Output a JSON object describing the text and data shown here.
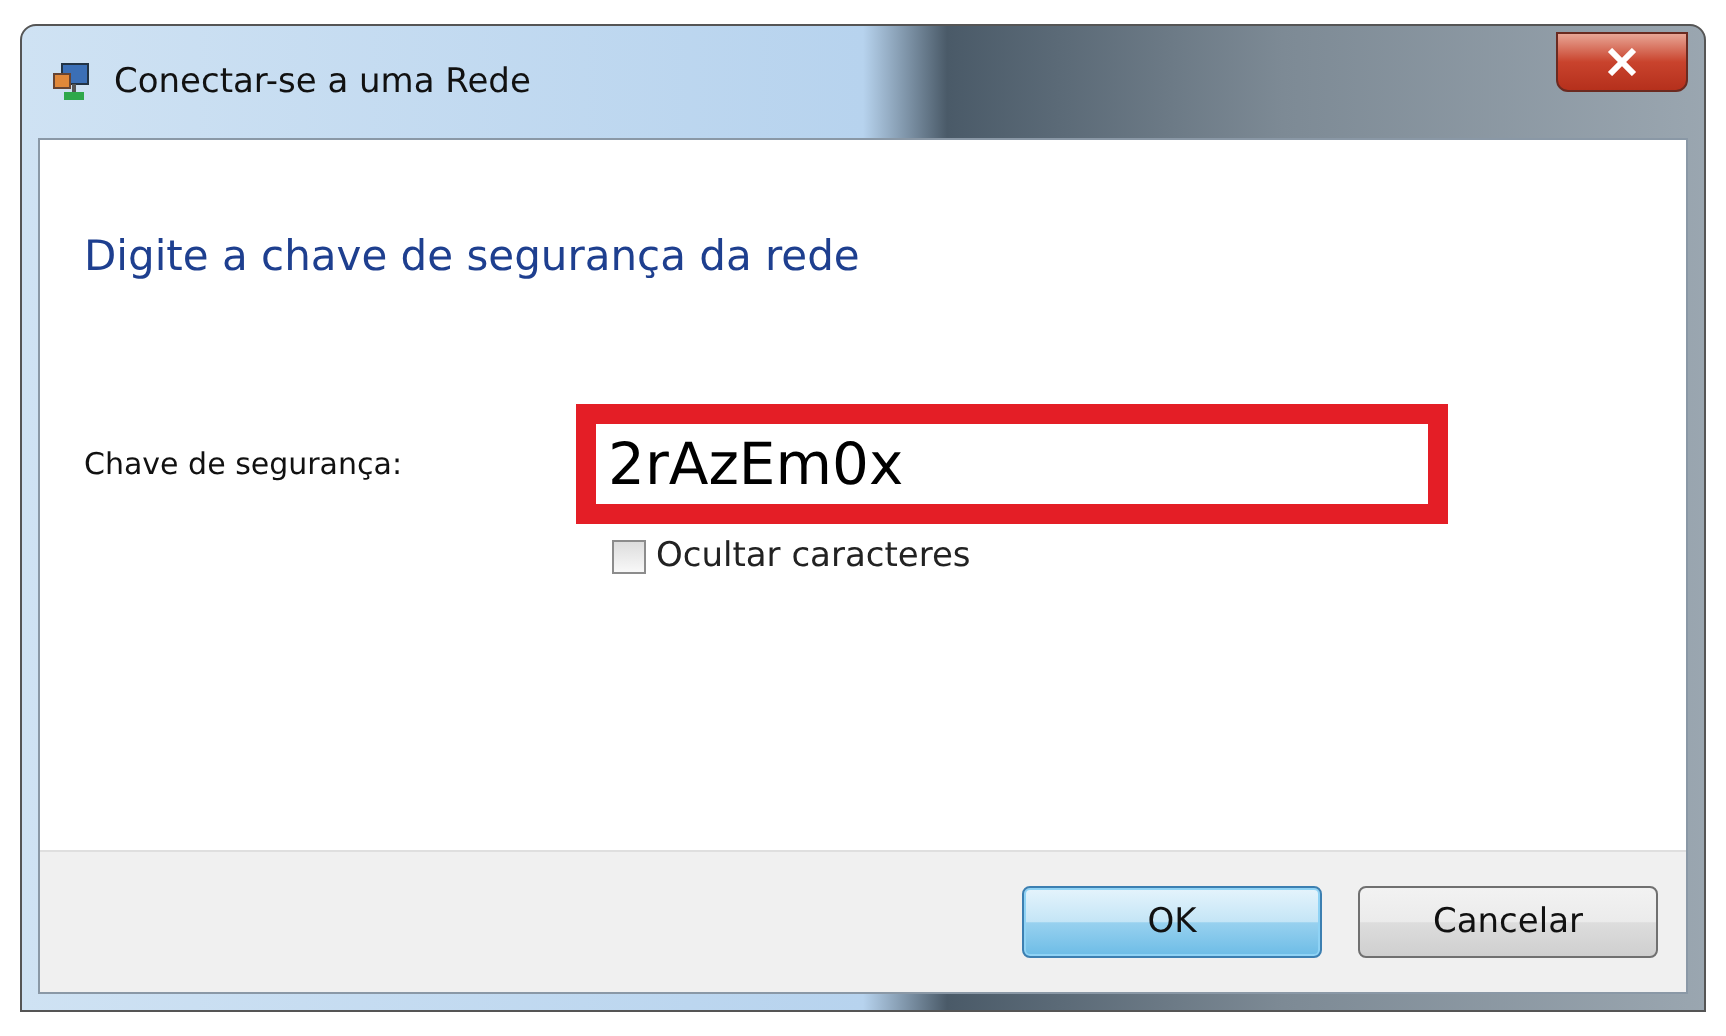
{
  "window": {
    "title": "Conectar-se a uma Rede"
  },
  "heading": "Digite a chave de segurança da rede",
  "security_key": {
    "label": "Chave de segurança:",
    "value": "2rAzEm0x",
    "highlighted": true
  },
  "hide_characters": {
    "label": "Ocultar caracteres",
    "checked": false
  },
  "buttons": [
    {
      "label": "OK",
      "default": true
    },
    {
      "label": "Cancelar",
      "default": false
    }
  ]
}
